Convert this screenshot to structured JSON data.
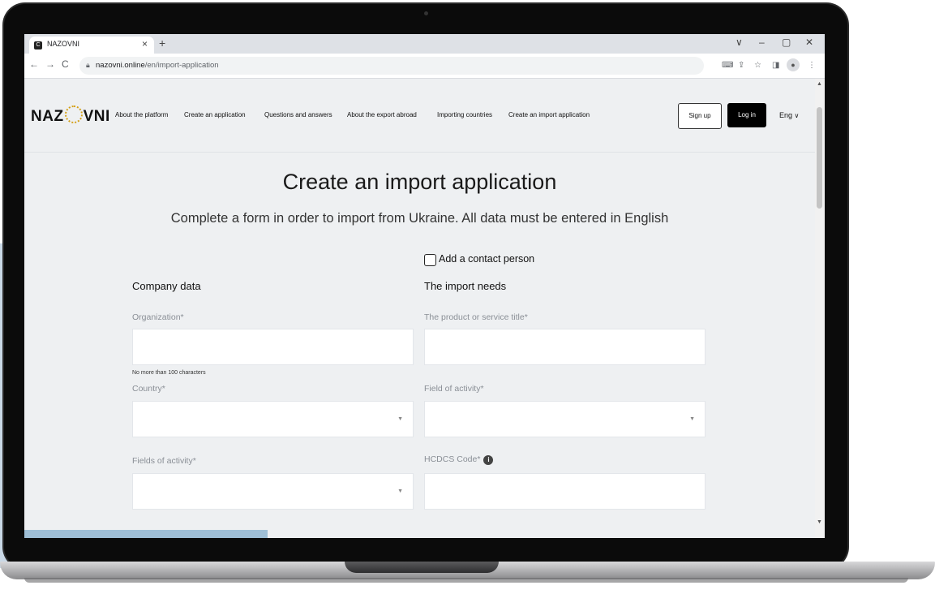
{
  "browser": {
    "tab_title": "NAZOVNI",
    "url_host": "nazovni.online",
    "url_path": "/en/import-application",
    "tab_close": "×",
    "new_tab": "+",
    "win_controls": [
      "∨",
      "–",
      "▢",
      "✕"
    ],
    "nav": {
      "back": "←",
      "forward": "→",
      "reload": "C"
    }
  },
  "header": {
    "logo_left": "NAZ",
    "logo_right": "VNI",
    "nav_links": [
      "About the platform",
      "Create an application",
      "Questions and answers",
      "About the export abroad",
      "Importing countries",
      "Create an import application"
    ],
    "signup_label": "Sign up",
    "login_label": "Log in",
    "language": "Eng"
  },
  "main": {
    "title": "Create an import application",
    "subtitle": "Complete a form in order to import from Ukraine. All data must be entered in English",
    "contact_checkbox_label": "Add a contact person",
    "company_section": "Company data",
    "import_section": "The import needs",
    "fields": {
      "organization_label": "Organization*",
      "organization_note": "No more than 100 characters",
      "country_label": "Country*",
      "fields_of_activity_label": "Fields of activity*",
      "product_title_label": "The product or service title*",
      "field_of_activity_label": "Field of activity*",
      "hcdcs_label": "HCDCS Code*"
    }
  }
}
